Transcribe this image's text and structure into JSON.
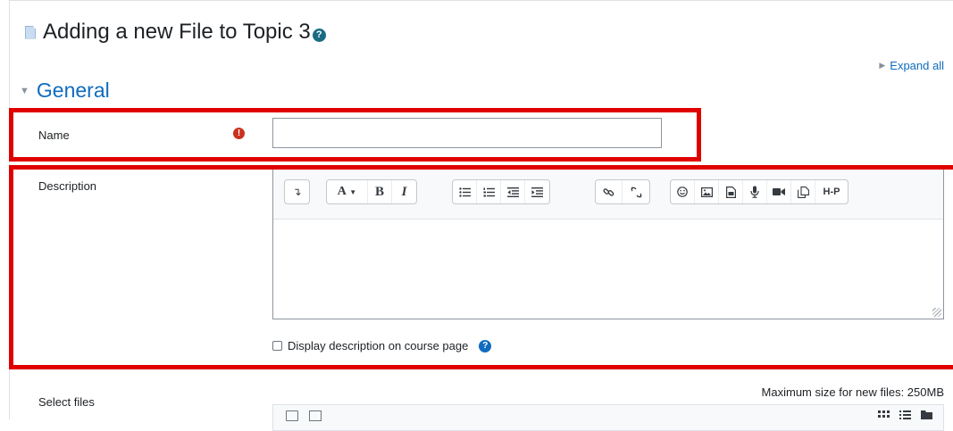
{
  "page": {
    "title": "Adding a new File to Topic 3",
    "help_icon": "question-circle-icon",
    "expand_all": "Expand all"
  },
  "section": {
    "title": "General"
  },
  "form": {
    "name_label": "Name",
    "name_value": "",
    "required_icon": "exclamation-circle-icon",
    "description_label": "Description",
    "display_description_label": "Display description on course page",
    "display_description_checked": false,
    "select_files_label": "Select files",
    "max_size": "Maximum size for new files: 250MB"
  },
  "toolbar": {
    "groups": [
      [
        {
          "name": "toolbar-toggle",
          "glyph": "↴"
        }
      ],
      [
        {
          "name": "paragraph-styles",
          "glyph": "A ▾"
        },
        {
          "name": "bold",
          "glyph": "B"
        },
        {
          "name": "italic",
          "glyph": "I"
        }
      ],
      [
        {
          "name": "unordered-list",
          "glyph": "☰"
        },
        {
          "name": "ordered-list",
          "glyph": "☰"
        },
        {
          "name": "outdent",
          "glyph": "⇤"
        },
        {
          "name": "indent",
          "glyph": "⇥"
        }
      ],
      [
        {
          "name": "link",
          "glyph": "🔗"
        },
        {
          "name": "unlink",
          "glyph": "⛓"
        }
      ],
      [
        {
          "name": "emoticon",
          "glyph": "☺"
        },
        {
          "name": "image",
          "glyph": "▣"
        },
        {
          "name": "media",
          "glyph": "▤"
        },
        {
          "name": "record-audio",
          "glyph": "🎤"
        },
        {
          "name": "record-video",
          "glyph": "■"
        },
        {
          "name": "manage-files",
          "glyph": "❐"
        },
        {
          "name": "h5p",
          "glyph": "H-P"
        }
      ]
    ]
  },
  "colors": {
    "link": "#0f6cbf",
    "required": "#ca3120",
    "highlight": "#e00000"
  }
}
